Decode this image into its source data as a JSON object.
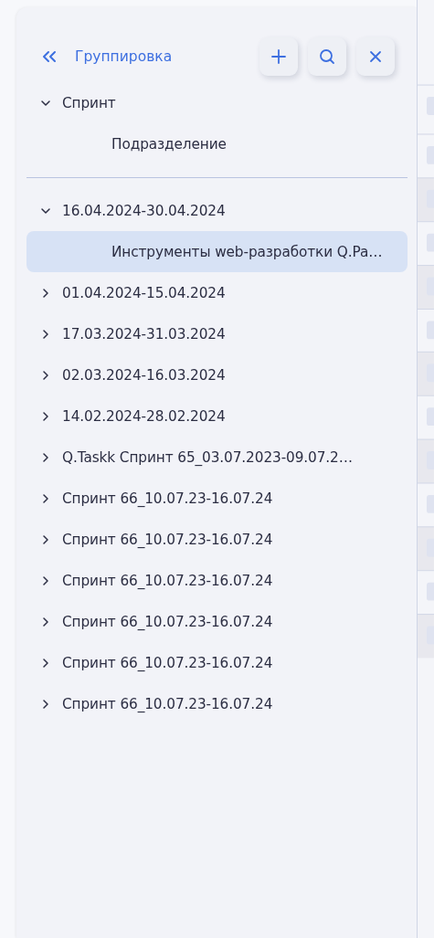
{
  "header": {
    "title": "Группировка"
  },
  "grouping": [
    {
      "label": "Спринт",
      "expanded": true,
      "children": [
        {
          "label": "Подразделение"
        }
      ]
    }
  ],
  "tree": [
    {
      "label": "16.04.2024-30.04.2024",
      "expanded": true,
      "selected": false,
      "children": [
        {
          "label": "Инструменты web-разработки Q.Pa…",
          "selected": true
        }
      ]
    },
    {
      "label": "01.04.2024-15.04.2024",
      "expanded": false,
      "selected": false
    },
    {
      "label": "17.03.2024-31.03.2024",
      "expanded": false,
      "selected": false
    },
    {
      "label": "02.03.2024-16.03.2024",
      "expanded": false,
      "selected": false
    },
    {
      "label": "14.02.2024-28.02.2024",
      "expanded": false,
      "selected": false
    },
    {
      "label": "Q.Taskk Спринт 65_03.07.2023-09.07.2…",
      "expanded": false,
      "selected": false
    },
    {
      "label": "Спринт 66_10.07.23-16.07.24",
      "expanded": false,
      "selected": false
    },
    {
      "label": "Спринт 66_10.07.23-16.07.24",
      "expanded": false,
      "selected": false
    },
    {
      "label": "Спринт 66_10.07.23-16.07.24",
      "expanded": false,
      "selected": false
    },
    {
      "label": "Спринт 66_10.07.23-16.07.24",
      "expanded": false,
      "selected": false
    },
    {
      "label": "Спринт 66_10.07.23-16.07.24",
      "expanded": false,
      "selected": false
    },
    {
      "label": "Спринт 66_10.07.23-16.07.24",
      "expanded": false,
      "selected": false
    }
  ]
}
